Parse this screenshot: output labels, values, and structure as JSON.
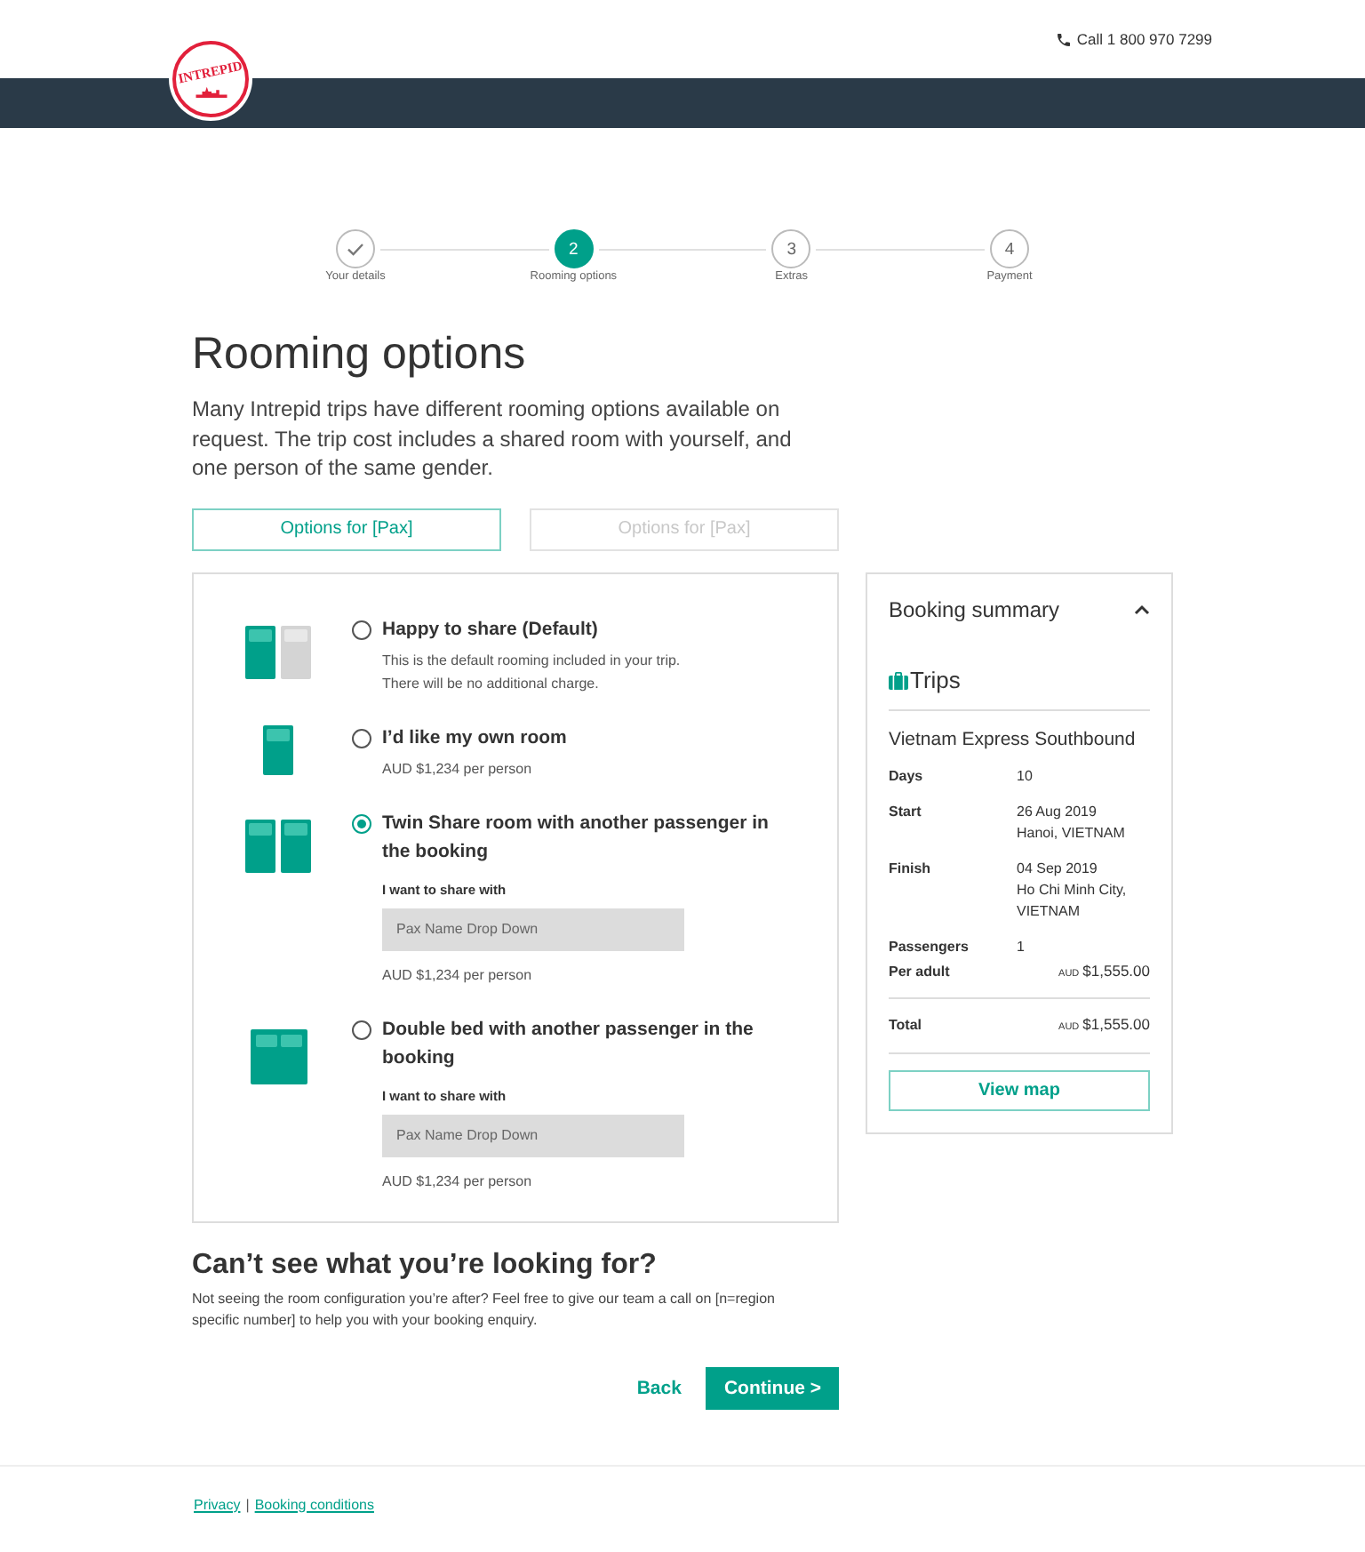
{
  "header": {
    "logo_text": "INTREPID",
    "phone": "Call 1 800 970 7299"
  },
  "steps": [
    {
      "label": "Your details",
      "completed": true,
      "selected": false
    },
    {
      "number": "2",
      "label": "Rooming options",
      "completed": false,
      "selected": true
    },
    {
      "number": "3",
      "label": "Extras",
      "completed": false,
      "selected": false
    },
    {
      "number": "4",
      "label": "Payment",
      "completed": false,
      "selected": false
    }
  ],
  "page": {
    "title": "Rooming options",
    "intro": "Many Intrepid trips have different rooming options available on request. The trip cost includes a shared room with yourself, and one person of the same gender."
  },
  "pax_tabs": [
    {
      "label": "Options for [Pax]",
      "selected": true
    },
    {
      "label": "Options for [Pax]",
      "selected": false
    }
  ],
  "room_options": [
    {
      "kind": "share",
      "title": "Happy to share (Default)",
      "selected": false,
      "description": [
        "This is the default rooming included in your trip.",
        "There will be no additional charge."
      ]
    },
    {
      "kind": "single",
      "title": "I’d like my own room",
      "selected": false,
      "price": "AUD $1,234 per person"
    },
    {
      "kind": "twin",
      "title": "Twin Share room with another passenger in the booking",
      "selected": true,
      "share_with": {
        "label": "I want to share with",
        "placeholder": "Pax Name Drop Down"
      },
      "price": "AUD $1,234 per person"
    },
    {
      "kind": "double",
      "title": "Double bed with another passenger in the booking",
      "selected": false,
      "share_with": {
        "label": "I want to share with",
        "placeholder": "Pax Name Drop Down"
      },
      "price": "AUD $1,234 per person"
    }
  ],
  "summary": {
    "title": "Booking summary",
    "expanded": true,
    "section": "Trips",
    "trip_name": "Vietnam Express Southbound",
    "details": [
      {
        "label": "Days",
        "value": [
          "10"
        ]
      },
      {
        "label": "Start",
        "value": [
          "26 Aug 2019",
          "Hanoi, VIETNAM"
        ]
      },
      {
        "label": "Finish",
        "value": [
          "04 Sep 2019",
          "Ho Chi Minh City, VIETNAM"
        ]
      },
      {
        "label": "Passengers",
        "value": [
          "1"
        ]
      }
    ],
    "per_adult": {
      "label": "Per adult",
      "currency": "AUD",
      "amount": "$1,555.00"
    },
    "total": {
      "label": "Total",
      "currency": "AUD",
      "amount": "$1,555.00"
    },
    "button": "View map"
  },
  "help": {
    "title": "Can’t see what you’re looking for?",
    "text": "Not seeing the room configuration you’re after? Feel free to give our team a call on [n=region specific number] to help you with your booking enquiry."
  },
  "actions": {
    "back": "Back",
    "continue": "Continue >"
  },
  "footer": {
    "links": [
      "Privacy",
      "Booking conditions"
    ],
    "separator": "|"
  }
}
